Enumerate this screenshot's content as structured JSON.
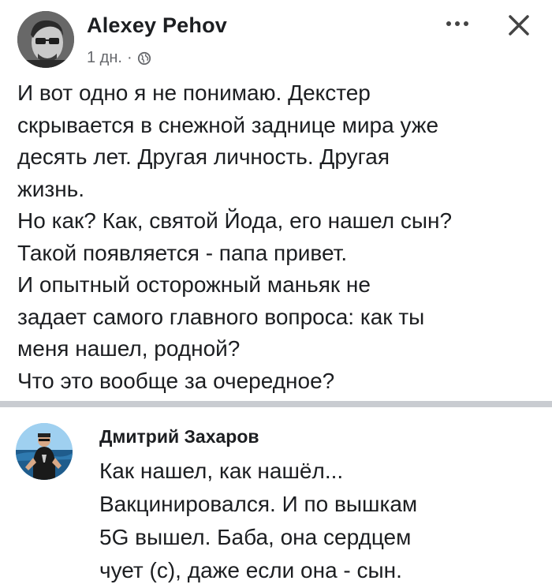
{
  "post": {
    "author": "Alexey Pehov",
    "time": "1 дн.",
    "separator": "·",
    "privacy_icon": "globe-icon",
    "more_icon": "more-options-icon",
    "close_icon": "close-icon",
    "lines": [
      "И вот одно я не понимаю. Декстер",
      "скрывается в снежной заднице мира уже",
      "десять лет. Другая личность. Другая",
      "жизнь.",
      "Но как? Как, святой Йода, его нашел сын?",
      "Такой появляется - папа привет.",
      "И опытный осторожный маньяк не",
      "задает самого главного вопроса: как ты",
      "меня нашел, родной?",
      "Что это вообще за очередное?"
    ]
  },
  "comment": {
    "author": "Дмитрий Захаров",
    "lines": [
      "Как нашел, как нашёл...",
      "Вакцинировался. И по вышкам",
      "5G вышел. Баба, она сердцем",
      "чует (с), даже если она - сын."
    ]
  },
  "colors": {
    "text": "#1c1e21",
    "meta": "#65676b",
    "divider": "#c9ccd1",
    "background": "#ffffff"
  }
}
